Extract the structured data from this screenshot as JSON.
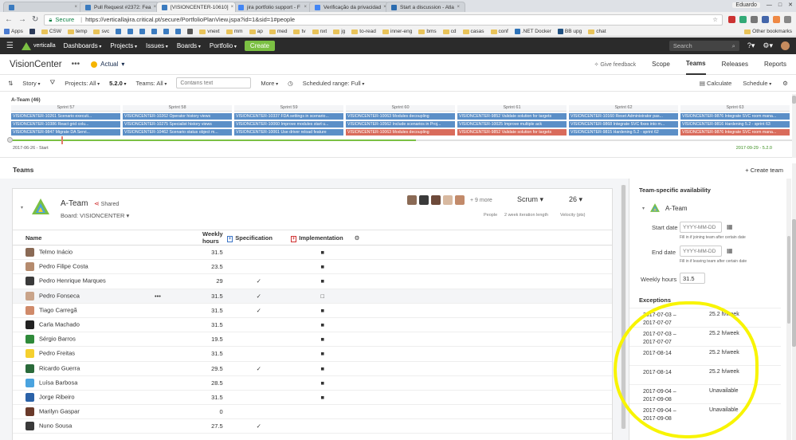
{
  "browser": {
    "tabs": [
      {
        "label": ""
      },
      {
        "label": "Pull Request #2372: Fea"
      },
      {
        "label": "[VISIONCENTER-10610]"
      },
      {
        "label": "jira portfolio support - F"
      },
      {
        "label": "Verificação da privacidad"
      },
      {
        "label": "Start a discussion - Atla"
      }
    ],
    "user": "Eduardo",
    "url_secure": "Secure",
    "url": "https://verticallajira.critical.pt/secure/PortfolioPlanView.jspa?id=1&sid=1#people",
    "bookmarks": [
      "Apps",
      "CSW",
      "temp",
      "svc",
      "vnext",
      "mm",
      "ap",
      "med",
      "tv",
      "nxt",
      "jg",
      "to-read",
      "inner-eng",
      "bms",
      "cd",
      "casas",
      "conf",
      ".NET Docker",
      "BB upg",
      "chat"
    ],
    "other_bookmarks": "Other bookmarks"
  },
  "jira": {
    "logo_text": "verticalla",
    "nav": [
      "Dashboards",
      "Projects",
      "Issues",
      "Boards",
      "Portfolio"
    ],
    "create": "Create",
    "search_placeholder": "Search"
  },
  "plan": {
    "title": "VisionCenter",
    "scenario": "Actual",
    "feedback": "Give feedback",
    "tabs": [
      "Scope",
      "Teams",
      "Releases",
      "Reports"
    ],
    "active_tab": "Teams"
  },
  "toolbar": {
    "story": "Story",
    "projects": "Projects: All",
    "release": "5.2.0",
    "teams": "Teams: All",
    "contains_placeholder": "Contains text",
    "more": "More",
    "scheduled": "Scheduled range: Full",
    "calculate": "Calculate",
    "schedule": "Schedule"
  },
  "timeline": {
    "team_label": "A-Team (46)",
    "start": "2017-06-26 - Start",
    "end": "2017-09-29 - 5.2.0",
    "sprints": [
      {
        "name": "Sprint 57",
        "items": [
          {
            "text": "VISIONCENTER-10261 Scenario executi...",
            "color": "blue"
          },
          {
            "text": "VISIONCENTER-10386 React grid colu...",
            "color": "blue"
          },
          {
            "text": "VISIONCENTER-9847 Migrate DA Servi...",
            "color": "blue"
          }
        ]
      },
      {
        "name": "Sprint 58",
        "items": [
          {
            "text": "VISIONCENTER-10262 Operator history views",
            "color": "blue"
          },
          {
            "text": "VISIONCENTER-10275 Specialist history views",
            "color": "blue"
          },
          {
            "text": "VISIONCENTER-10462 Scenario status object m...",
            "color": "blue"
          }
        ]
      },
      {
        "name": "Sprint 59",
        "items": [
          {
            "text": "VISIONCENTER-10337 FDA settings in scenario...",
            "color": "blue"
          },
          {
            "text": "VISIONCENTER-10060 Improve modules start u...",
            "color": "blue"
          },
          {
            "text": "VISIONCENTER-10061 Use driver reload feature",
            "color": "blue"
          }
        ]
      },
      {
        "name": "Sprint 60",
        "items": [
          {
            "text": "VISIONCENTER-10063 Modules decoupling",
            "color": "blue"
          },
          {
            "text": "VISIONCENTER-10562 Include scenarios in Proj...",
            "color": "blue"
          },
          {
            "text": "VISIONCENTER-10063 Modules decoupling",
            "color": "red"
          }
        ]
      },
      {
        "name": "Sprint 61",
        "items": [
          {
            "text": "VISIONCENTER-9852 Validate solution for targets",
            "color": "blue"
          },
          {
            "text": "VISIONCENTER-10025 Improve multiple ack",
            "color": "blue"
          },
          {
            "text": "VISIONCENTER-9852 Validate solution for targets",
            "color": "red"
          }
        ]
      },
      {
        "name": "Sprint 62",
        "items": [
          {
            "text": "VISIONCENTER-10160 Reset Administrator pas...",
            "color": "blue"
          },
          {
            "text": "VISIONCENTER-9868 Integrate SVC fixes into m...",
            "color": "blue"
          },
          {
            "text": "VISIONCENTER-9815 Hardening 5.2 - sprint 62",
            "color": "blue"
          }
        ]
      },
      {
        "name": "Sprint 63",
        "items": [
          {
            "text": "VISIONCENTER-9876 Integrate SVC room mana...",
            "color": "blue"
          },
          {
            "text": "VISIONCENTER-9816 Hardening 5.2 - sprint 63",
            "color": "blue"
          },
          {
            "text": "VISIONCENTER-9876 Integrate SVC room mana...",
            "color": "red"
          }
        ]
      }
    ]
  },
  "teams": {
    "title": "Teams",
    "create": "+ Create team",
    "card": {
      "name": "A-Team",
      "shared": "Shared",
      "board": "Board: VISIONCENTER",
      "more_people": "+ 9 more",
      "people_label": "People",
      "method": "Scrum",
      "method_label": "2 week iteration length",
      "velocity": "26",
      "velocity_label": "Velocity (pts)"
    },
    "columns": {
      "name": "Name",
      "hours": "Weekly hours",
      "spec": "Specification",
      "impl": "Implementation"
    },
    "members": [
      {
        "name": "Telmo Inácio",
        "hours": "31.5",
        "spec": "",
        "impl": "■"
      },
      {
        "name": "Pedro Filipe Costa",
        "hours": "23.5",
        "spec": "",
        "impl": "■"
      },
      {
        "name": "Pedro Henrique Marques",
        "hours": "29",
        "spec": "✓",
        "impl": "■"
      },
      {
        "name": "Pedro Fonseca",
        "hours": "31.5",
        "spec": "✓",
        "impl": "□",
        "dots": "•••"
      },
      {
        "name": "Tiago Carregã",
        "hours": "31.5",
        "spec": "✓",
        "impl": "■"
      },
      {
        "name": "Carla Machado",
        "hours": "31.5",
        "spec": "",
        "impl": "■"
      },
      {
        "name": "Sérgio Barros",
        "hours": "19.5",
        "spec": "",
        "impl": "■"
      },
      {
        "name": "Pedro Freitas",
        "hours": "31.5",
        "spec": "",
        "impl": "■"
      },
      {
        "name": "Ricardo Guerra",
        "hours": "29.5",
        "spec": "✓",
        "impl": "■"
      },
      {
        "name": "Luísa Barbosa",
        "hours": "28.5",
        "spec": "",
        "impl": "■"
      },
      {
        "name": "Jorge Ribeiro",
        "hours": "31.5",
        "spec": "",
        "impl": "■"
      },
      {
        "name": "Marilyn Gaspar",
        "hours": "0",
        "spec": "",
        "impl": ""
      },
      {
        "name": "Nuno Sousa",
        "hours": "27.5",
        "spec": "✓",
        "impl": ""
      }
    ]
  },
  "availability": {
    "title": "Team-specific availability",
    "team": "A-Team",
    "start_label": "Start date",
    "start_placeholder": "YYYY-MM-DD",
    "start_hint": "Fill in if joining team after certain date",
    "end_label": "End date",
    "end_placeholder": "YYYY-MM-DD",
    "end_hint": "Fill in if leaving team after certain date",
    "weekly_label": "Weekly hours",
    "weekly_value": "31.5",
    "exceptions_title": "Exceptions",
    "exceptions": [
      {
        "line1": "2017-07-03 –",
        "line2": "2017-07-07",
        "value": "25.2 h/week"
      },
      {
        "line1": "2017-07-03 –",
        "line2": "2017-07-07",
        "value": "25.2 h/week"
      },
      {
        "line1": "2017-08-14",
        "line2": "",
        "value": "25.2 h/week"
      },
      {
        "line1": "2017-08-14",
        "line2": "",
        "value": "25.2 h/week"
      },
      {
        "line1": "2017-09-04 –",
        "line2": "2017-09-08",
        "value": "Unavailable"
      },
      {
        "line1": "2017-09-04 –",
        "line2": "2017-09-08",
        "value": "Unavailable"
      }
    ]
  },
  "colors": {
    "accent": "#7bc043",
    "bar_blue": "#5b8fc7",
    "bar_red": "#d96b5b",
    "highlight": "#f8f400"
  }
}
